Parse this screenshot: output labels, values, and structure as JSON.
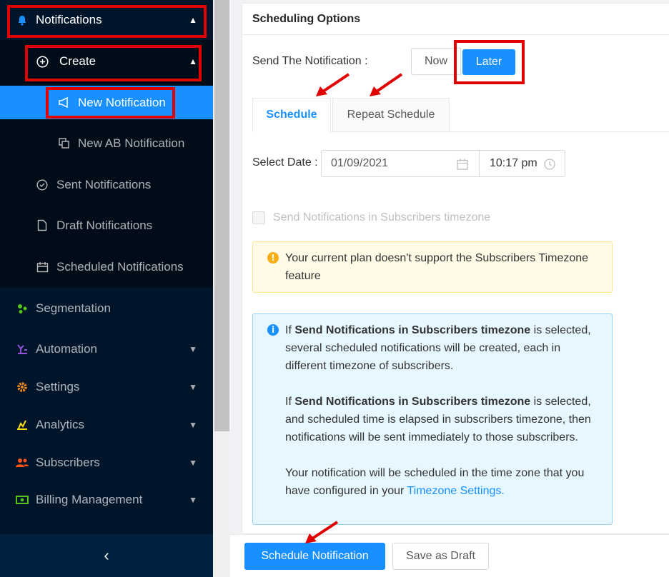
{
  "sidebar": {
    "notifications_label": "Notifications",
    "create_label": "Create",
    "items": [
      {
        "label": "New Notification",
        "icon": "megaphone-icon"
      },
      {
        "label": "New AB Notification",
        "icon": "copy-icon"
      },
      {
        "label": "Sent Notifications",
        "icon": "check-circle-icon"
      },
      {
        "label": "Draft Notifications",
        "icon": "file-icon"
      },
      {
        "label": "Scheduled Notifications",
        "icon": "calendar-icon"
      }
    ],
    "menu": [
      {
        "label": "Segmentation",
        "icon": "cluster-icon",
        "color": "#52c41a"
      },
      {
        "label": "Automation",
        "icon": "robot-icon",
        "color": "#9254de"
      },
      {
        "label": "Settings",
        "icon": "gear-icon",
        "color": "#fa8c16"
      },
      {
        "label": "Analytics",
        "icon": "chart-icon",
        "color": "#fadb14"
      },
      {
        "label": "Subscribers",
        "icon": "users-icon",
        "color": "#fa541c"
      },
      {
        "label": "Billing Management",
        "icon": "money-icon",
        "color": "#52c41a"
      }
    ],
    "collapse_glyph": "‹"
  },
  "card": {
    "title": "Scheduling Options",
    "send_label": "Send The Notification",
    "now_label": "Now",
    "later_label": "Later",
    "tabs": [
      "Schedule",
      "Repeat Schedule"
    ],
    "date_label": "Select Date",
    "date_value": "01/09/2021",
    "time_value": "10:17 pm",
    "tz_checkbox_label": "Send Notifications in Subscribers timezone",
    "warning": "Your current plan doesn't support the Subscribers Timezone feature",
    "info": {
      "p1_prefix": "If ",
      "p1_bold": "Send Notifications in Subscribers timezone",
      "p1_suffix": " is selected, several scheduled notifications will be created, each in different timezone of subscribers.",
      "p2_prefix": "If ",
      "p2_bold": "Send Notifications in Subscribers timezone",
      "p2_suffix": " is selected, and scheduled time is elapsed in subscribers timezone, then notifications will be sent immediately to those subscribers.",
      "p3_prefix": "Your notification will be scheduled in the time zone that you have configured in your ",
      "p3_link": "Timezone Settings."
    }
  },
  "footer": {
    "schedule_label": "Schedule Notification",
    "draft_label": "Save as Draft"
  },
  "colors": {
    "primary": "#1890ff",
    "sidebar_bg": "#001529",
    "highlight": "#e00000"
  }
}
